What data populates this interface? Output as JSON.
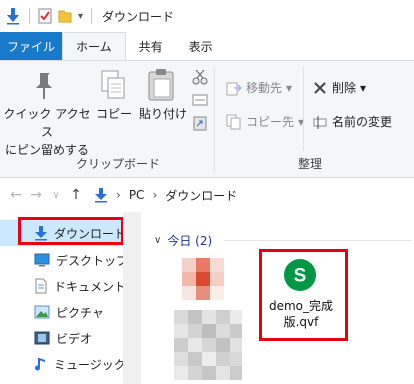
{
  "window": {
    "title": "ダウンロード"
  },
  "tabs": {
    "file": "ファイル",
    "home": "ホーム",
    "share": "共有",
    "view": "表示"
  },
  "ribbon": {
    "pin_label_1": "クイック アクセス",
    "pin_label_2": "にピン留めする",
    "copy": "コピー",
    "paste": "貼り付け",
    "move_to": "移動先",
    "copy_to": "コピー先",
    "delete": "削除",
    "rename": "名前の変更",
    "group_clipboard": "クリップボード",
    "group_organize": "整理"
  },
  "address": {
    "pc": "PC",
    "folder": "ダウンロード"
  },
  "nav": [
    {
      "label": "ダウンロード"
    },
    {
      "label": "デスクトップ"
    },
    {
      "label": "ドキュメント"
    },
    {
      "label": "ピクチャ"
    },
    {
      "label": "ビデオ"
    },
    {
      "label": "ミュージック"
    }
  ],
  "content": {
    "group_header": "今日 (2)",
    "file": {
      "line1": "demo_完成",
      "line2": "版.qvf",
      "icon_letter": "S"
    }
  },
  "colors": {
    "accent": "#1979ca",
    "highlight": "#e60012",
    "qlik_green": "#009845"
  }
}
